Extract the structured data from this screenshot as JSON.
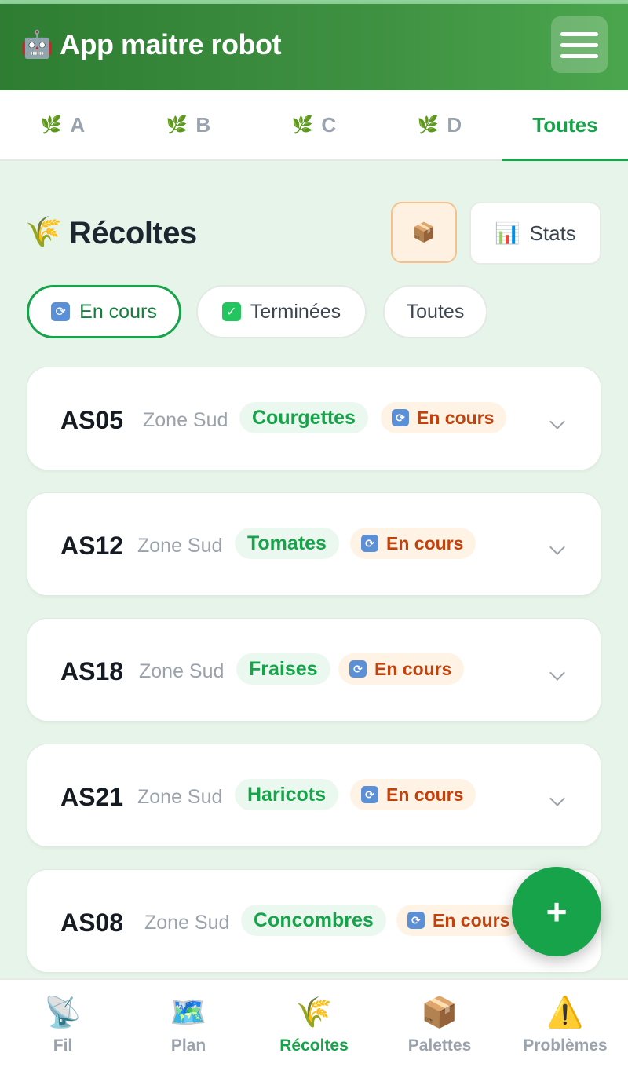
{
  "header": {
    "logo_icon": "🤖",
    "title": "App maitre robot",
    "menu_icon": "hamburger-icon"
  },
  "zone_tabs": [
    {
      "icon": "🌿",
      "label": "A"
    },
    {
      "icon": "🌿",
      "label": "B"
    },
    {
      "icon": "🌿",
      "label": "C"
    },
    {
      "icon": "🌿",
      "label": "D"
    },
    {
      "label": "Toutes",
      "active": true
    }
  ],
  "section": {
    "icon": "🌾",
    "title": "Récoltes",
    "box_icon": "📦",
    "stats_icon": "📊",
    "stats_label": "Stats"
  },
  "filters": [
    {
      "icon": "🔄",
      "label": "En cours",
      "active": true
    },
    {
      "icon": "✅",
      "label": "Terminées"
    },
    {
      "label": "Toutes"
    }
  ],
  "harvests": [
    {
      "code": "AS05",
      "zone": "Zone Sud",
      "crop": "Courgettes",
      "status_icon": "🔄",
      "status": "En cours"
    },
    {
      "code": "AS12",
      "zone": "Zone Sud",
      "crop": "Tomates",
      "status_icon": "🔄",
      "status": "En cours"
    },
    {
      "code": "AS18",
      "zone": "Zone Sud",
      "crop": "Fraises",
      "status_icon": "🔄",
      "status": "En cours"
    },
    {
      "code": "AS21",
      "zone": "Zone Sud",
      "crop": "Haricots",
      "status_icon": "🔄",
      "status": "En cours"
    },
    {
      "code": "AS08",
      "zone": "Zone Sud",
      "crop": "Concombres",
      "status_icon": "🔄",
      "status": "En cours"
    }
  ],
  "fab": {
    "label": "+"
  },
  "bottom_nav": [
    {
      "icon": "📡",
      "label": "Fil"
    },
    {
      "icon": "🗺️",
      "label": "Plan"
    },
    {
      "icon": "🌾",
      "label": "Récoltes",
      "active": true
    },
    {
      "icon": "📦",
      "label": "Palettes"
    },
    {
      "icon": "⚠️",
      "label": "Problèmes"
    }
  ],
  "colors": {
    "primary": "#16a34a",
    "header": "#2e7d32",
    "status": "#c2410c",
    "background": "#e6f4e9"
  }
}
